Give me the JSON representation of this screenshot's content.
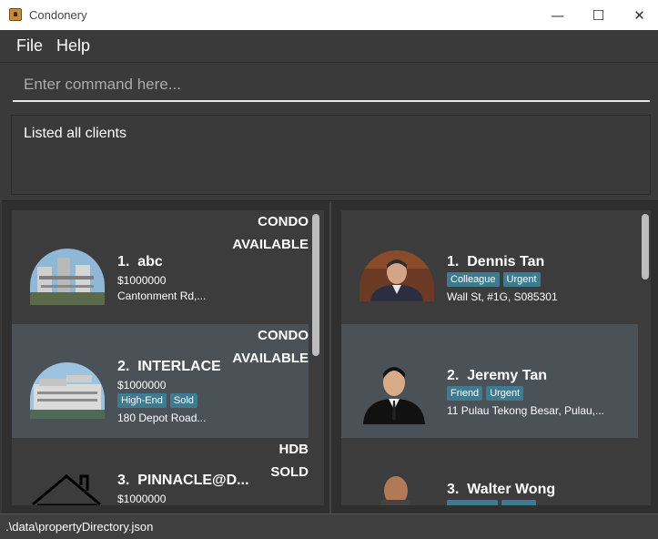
{
  "window": {
    "title": "Condonery",
    "minimize": "—",
    "maximize": "☐",
    "close": "✕"
  },
  "menu": {
    "file": "File",
    "help": "Help"
  },
  "command": {
    "placeholder": "Enter command here..."
  },
  "result": {
    "text": "Listed all clients"
  },
  "properties": [
    {
      "index": "1.",
      "name": "abc",
      "price": "$1000000",
      "address": "Cantonment Rd,...",
      "type": "CONDO",
      "status": "AVAILABLE",
      "tags": []
    },
    {
      "index": "2.",
      "name": "INTERLACE",
      "price": "$1000000",
      "address": "180 Depot Road...",
      "type": "CONDO",
      "status": "AVAILABLE",
      "tags": [
        "High-End",
        "Sold"
      ]
    },
    {
      "index": "3.",
      "name": "PINNACLE@D...",
      "price": "$1000000",
      "address": "",
      "type": "HDB",
      "status": "SOLD",
      "tags": []
    }
  ],
  "clients": [
    {
      "index": "1.",
      "name": "Dennis Tan",
      "address": "Wall St, #1G, S085301",
      "tags": [
        "Colleague",
        "Urgent"
      ]
    },
    {
      "index": "2.",
      "name": "Jeremy Tan",
      "address": "11 Pulau Tekong Besar, Pulau,...",
      "tags": [
        "Friend",
        "Urgent"
      ]
    },
    {
      "index": "3.",
      "name": "Walter Wong",
      "address": "",
      "tags": []
    }
  ],
  "status_bar": {
    "path": ".\\data\\propertyDirectory.json"
  },
  "colors": {
    "background": "#3a3a3a",
    "card": "#3c3c3c",
    "card_selected": "#4b5257",
    "tag": "#3e7b91"
  }
}
